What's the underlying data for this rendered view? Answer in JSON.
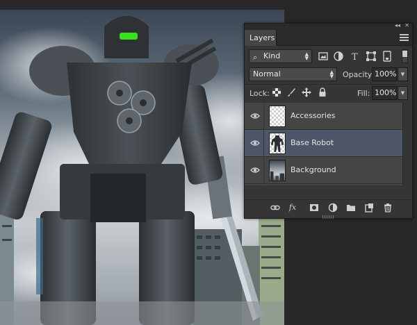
{
  "panel": {
    "tab_label": "Layers",
    "collapse_icon": "double-chevron-icon",
    "menu_icon": "panel-menu-icon"
  },
  "filter": {
    "kind_label": "Kind",
    "icons": [
      "image-filter-icon",
      "adjustment-filter-icon",
      "type-filter-icon",
      "shape-filter-icon",
      "smart-object-filter-icon"
    ]
  },
  "blend": {
    "mode": "Normal",
    "opacity_label": "Opacity:",
    "opacity_value": "100%"
  },
  "lock": {
    "label": "Lock:",
    "icons": [
      "lock-transparent-icon",
      "lock-image-icon",
      "lock-position-icon",
      "lock-all-icon"
    ],
    "fill_label": "Fill:",
    "fill_value": "100%"
  },
  "layers": [
    {
      "name": "Accessories",
      "visible": true,
      "selected": false
    },
    {
      "name": "Base Robot",
      "visible": true,
      "selected": true
    },
    {
      "name": "Background",
      "visible": true,
      "selected": false
    }
  ],
  "bottom_icons": [
    "link-layers-icon",
    "fx-icon",
    "add-mask-icon",
    "adjustment-layer-icon",
    "new-group-icon",
    "new-layer-icon",
    "trash-icon"
  ],
  "bottom_fx_label": "fx",
  "colors": {
    "panel_bg": "#353535",
    "layer_list_bg": "#454545",
    "selected_layer": "#4e5669",
    "robot_eye": "#39e01f"
  }
}
